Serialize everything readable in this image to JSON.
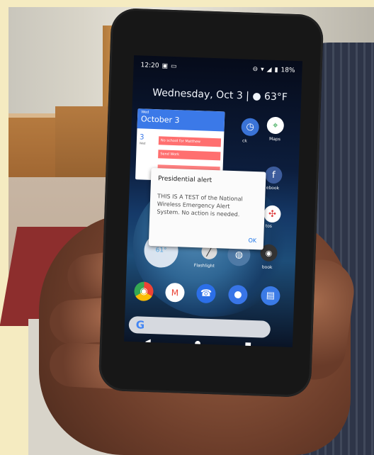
{
  "status_bar": {
    "time": "12:20",
    "left_icons": [
      "notification-icon",
      "message-icon"
    ],
    "right_icons": [
      "do-not-disturb-icon",
      "wifi-icon",
      "signal-icon",
      "battery-icon"
    ],
    "battery": "18%"
  },
  "home_screen": {
    "date_weather": "Wednesday, Oct 3 | ● 63°F",
    "calendar": {
      "weekday": "Wed",
      "date": "October 3",
      "day_number": "3",
      "day_name": "Wed",
      "events": [
        "No school for Matthew",
        "Send Work",
        ""
      ]
    },
    "app_labels": {
      "clock": "ck",
      "maps": "Maps",
      "facebook": "ebook",
      "photos": "tos",
      "flashlight": "Flashlight",
      "camera": "book"
    },
    "weather_widget": "61°",
    "search_logo": "G"
  },
  "alert": {
    "title": "Presidential alert",
    "message": "THIS IS A TEST of the National\nWireless Emergency Alert\nSystem. No action is needed.",
    "ok_label": "OK"
  },
  "navigation": [
    "◀",
    "●",
    "■"
  ],
  "colors": {
    "alert_accent": "#1a73e8",
    "calendar_accent": "#3b79e8"
  }
}
